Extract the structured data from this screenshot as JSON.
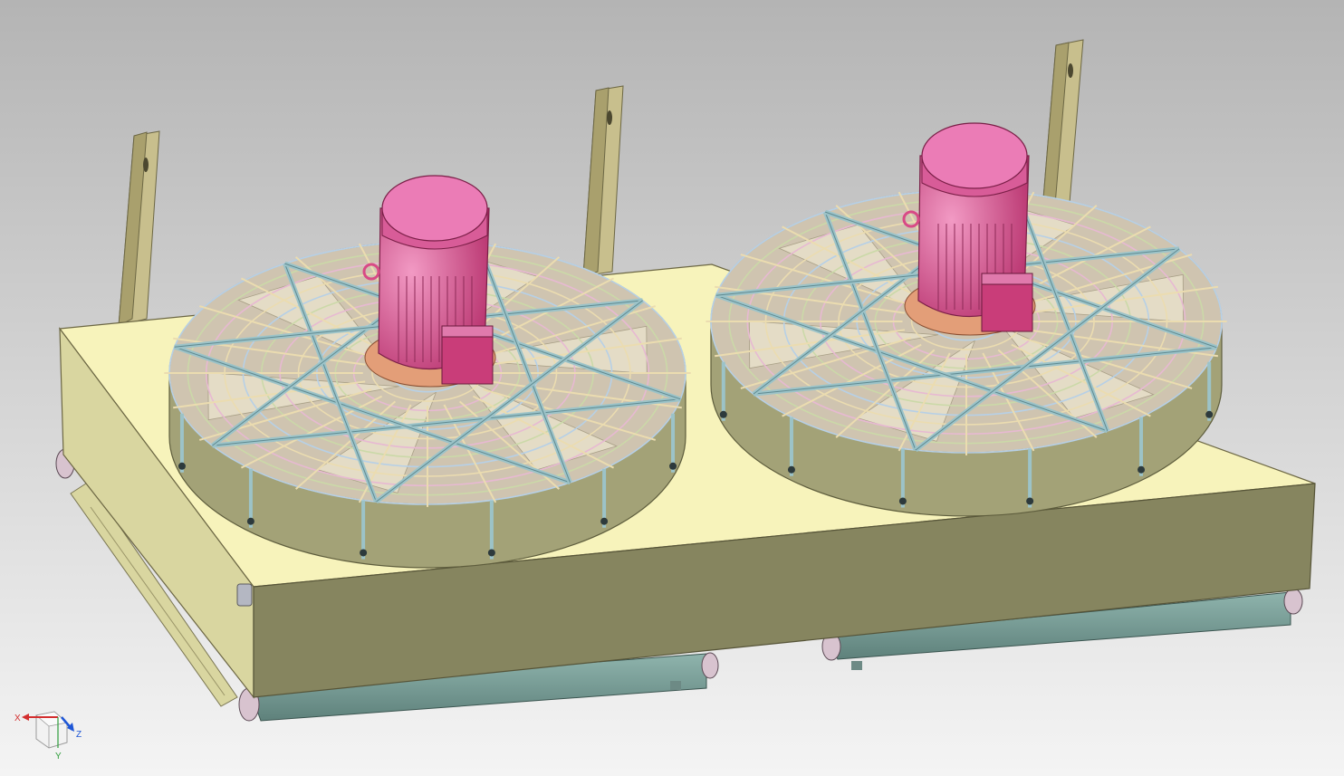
{
  "colors": {
    "background_top": "#b4b4b4",
    "background_bottom": "#f4f4f4",
    "housing_top": "#f7f3bb",
    "housing_front": "#86855f",
    "housing_left": "#d9d6a0",
    "shroud": "#a3a277",
    "motor": "#d84a86",
    "motor_cap": "#eb7cb6",
    "guard_wire": "#ebdcb0",
    "guard_strut": "#9cc3c8",
    "coil_box": "#7ea29b",
    "pipe": "#d8c3cf",
    "bracket": "#c8bf8d",
    "axis_x": "#d32f2f",
    "axis_y": "#2e9d3a",
    "axis_z": "#1e56d6"
  },
  "scene": {
    "model": "dual-fan-cooler-assembly",
    "fans": [
      {
        "name": "fan-left"
      },
      {
        "name": "fan-right"
      }
    ]
  },
  "triad": {
    "x_label": "X",
    "y_label": "Y",
    "z_label": "Z"
  }
}
